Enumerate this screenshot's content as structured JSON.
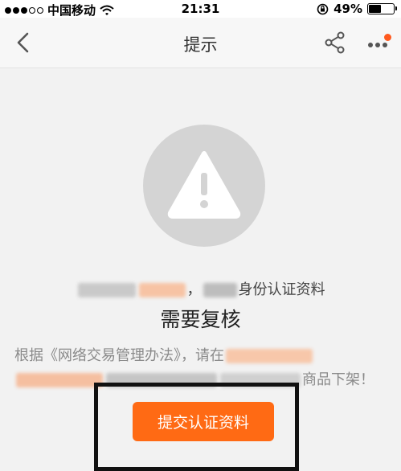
{
  "status_bar": {
    "carrier": "中国移动",
    "time": "21:31",
    "battery": "49%",
    "battery_level": 0.49
  },
  "nav": {
    "title": "提示"
  },
  "content": {
    "line1_visible": "身份认证资料",
    "line1_suffix_separator": "，",
    "heading": "需要复核",
    "para_prefix": "根据《网络交易管理办法》，请在",
    "para_suffix": "商品下架！",
    "submit_button": "提交认证资料"
  },
  "colors": {
    "accent": "#ff6a14",
    "badge": "#ff5a1f",
    "icon_circle": "#d4d4d4"
  },
  "icons": {
    "back": "chevron-left-icon",
    "share": "share-icon",
    "more": "more-icon",
    "warning": "warning-icon",
    "wifi": "wifi-icon",
    "lock": "rotation-lock-icon",
    "battery": "battery-icon"
  }
}
